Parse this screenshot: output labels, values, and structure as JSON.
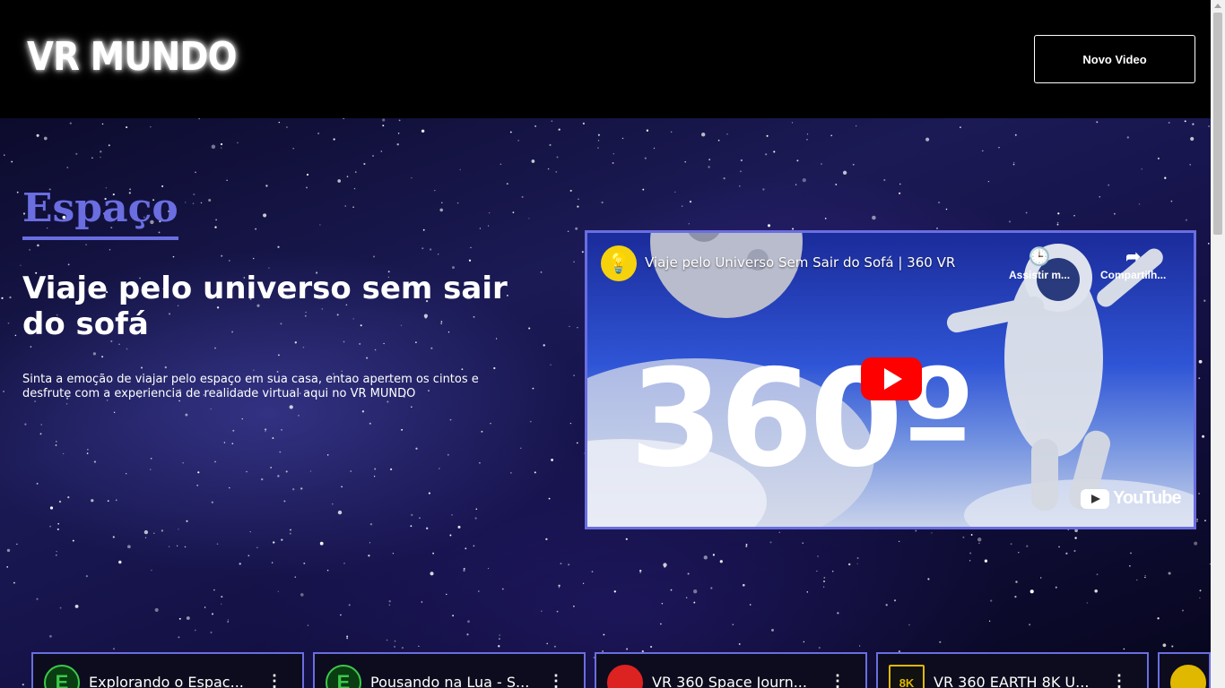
{
  "header": {
    "logo": "VR MUNDO",
    "new_video_button": "Novo Video"
  },
  "hero": {
    "section_title": "Espaço",
    "headline": "Viaje pelo universo sem sair do sofá",
    "description": "Sinta a emoção de viajar pelo espaço em sua casa, entao apertem os cintos e desfrute com a experiencia de realidade virtual aqui no VR MUNDO"
  },
  "player": {
    "video_title": "Viaje pelo Universo Sem Sair do Sofá | 360 VR",
    "watch_later_label": "Assistir m...",
    "share_label": "Compartilh...",
    "thumbnail_text": "360º",
    "brand": "YouTube",
    "channel_icon": "lightbulb-icon"
  },
  "cards": [
    {
      "title": "Explorando o Espac...",
      "avatar": "E"
    },
    {
      "title": "Pousando na Lua - S...",
      "avatar": "E"
    },
    {
      "title": "VR 360 Space Journ...",
      "avatar": ""
    },
    {
      "title": "VR 360 EARTH 8K U...",
      "avatar": "8K"
    },
    {
      "title": "",
      "avatar": ""
    }
  ],
  "colors": {
    "accent": "#6a6ee0",
    "background": "#000000",
    "youtube_red": "#ff0000"
  }
}
